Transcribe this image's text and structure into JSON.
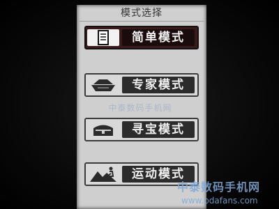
{
  "screen": {
    "title": "模式选择",
    "items": [
      {
        "label": "简单模式",
        "icon": "document-icon",
        "selected": true
      },
      {
        "label": "专家模式",
        "icon": "boat-icon",
        "selected": false
      },
      {
        "label": "寻宝模式",
        "icon": "treasure-chest-icon",
        "selected": false
      },
      {
        "label": "运动模式",
        "icon": "mountain-hiker-icon",
        "selected": false
      }
    ],
    "ghost_text": "中泰数码手机网"
  },
  "watermark": {
    "line1": "中泰数码手机网",
    "line2": "www.pdafans.com"
  },
  "colors": {
    "screen_bg": "#cfcfcf",
    "label_bg": "#2b2b2b",
    "selected_bg": "#3b1a1a",
    "watermark": "#7fa9d8"
  }
}
